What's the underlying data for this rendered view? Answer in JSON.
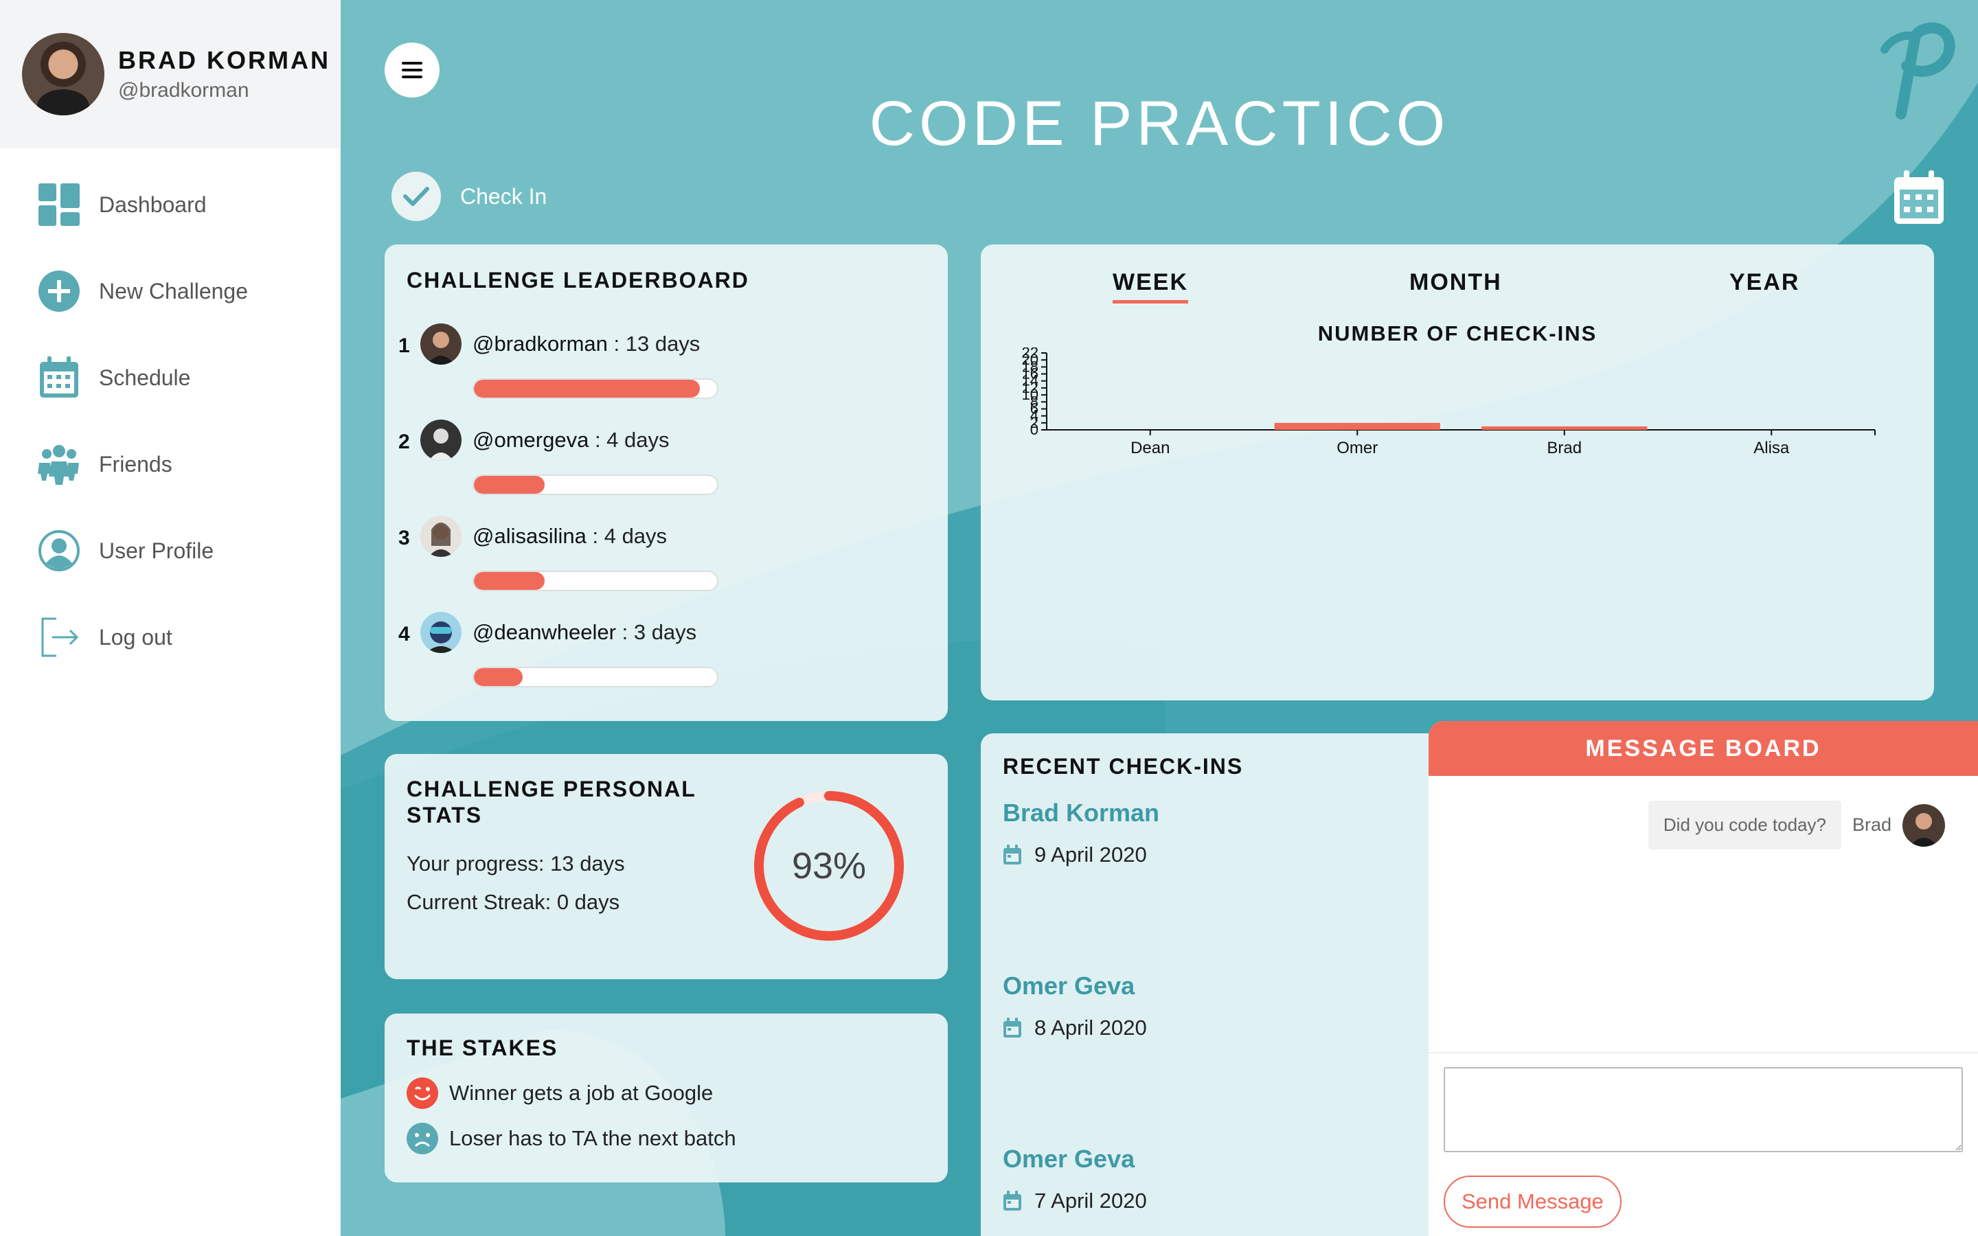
{
  "user": {
    "name": "BRAD KORMAN",
    "handle": "@bradkorman"
  },
  "sidebar": {
    "items": [
      {
        "label": "Dashboard",
        "icon": "dashboard-icon"
      },
      {
        "label": "New Challenge",
        "icon": "plus-circle-icon"
      },
      {
        "label": "Schedule",
        "icon": "calendar-icon"
      },
      {
        "label": "Friends",
        "icon": "friends-icon"
      },
      {
        "label": "User Profile",
        "icon": "user-icon"
      },
      {
        "label": "Log out",
        "icon": "logout-icon"
      }
    ]
  },
  "header": {
    "title": "CODE PRACTICO",
    "checkin_label": "Check In"
  },
  "leaderboard": {
    "title": "CHALLENGE LEADERBOARD",
    "entries": [
      {
        "rank": "1",
        "user": "@bradkorman",
        "days": " : 13 days",
        "progress": 0.93
      },
      {
        "rank": "2",
        "user": "@omergeva",
        "days": " : 4 days",
        "progress": 0.29
      },
      {
        "rank": "3",
        "user": "@alisasilina",
        "days": " : 4 days",
        "progress": 0.29
      },
      {
        "rank": "4",
        "user": "@deanwheeler",
        "days": " : 3 days",
        "progress": 0.2
      }
    ]
  },
  "chart_card": {
    "tabs": [
      "WEEK",
      "MONTH",
      "YEAR"
    ],
    "active_tab": "WEEK",
    "title": "NUMBER OF CHECK-INS"
  },
  "chart_data": {
    "type": "bar",
    "title": "NUMBER OF CHECK-INS",
    "categories": [
      "Dean",
      "Omer",
      "Brad",
      "Alisa"
    ],
    "values": [
      0,
      2,
      1,
      0
    ],
    "ylim": [
      0,
      22
    ],
    "yticks": [
      "0",
      "2",
      "4",
      "6",
      "8",
      "10",
      "12",
      "14",
      "16",
      "18",
      "20",
      "22"
    ],
    "xlabel": "",
    "ylabel": "",
    "color": "#f06a5a"
  },
  "stats": {
    "title": "CHALLENGE PERSONAL STATS",
    "progress_label": "Your progress:",
    "progress_value": " 13 days",
    "streak_label": "Current Streak:",
    "streak_value": " 0 days",
    "percent": "93%",
    "percent_value": 0.93
  },
  "stakes": {
    "title": "THE STAKES",
    "items": [
      {
        "text": "Winner gets a job at Google",
        "icon": "happy-face-icon"
      },
      {
        "text": "Loser has to TA the next batch",
        "icon": "sad-face-icon"
      }
    ]
  },
  "recent": {
    "title": "RECENT CHECK-INS",
    "entries": [
      {
        "name": "Brad Korman",
        "date": "9 April 2020"
      },
      {
        "name": "Omer Geva",
        "date": "8 April 2020"
      },
      {
        "name": "Omer Geva",
        "date": "7 April 2020"
      }
    ]
  },
  "message_board": {
    "title": "MESSAGE BOARD",
    "messages": [
      {
        "text": "Did you code today?",
        "author": "Brad"
      }
    ],
    "input_value": "",
    "send_label": "Send Message"
  },
  "colors": {
    "accent": "#f06a5a",
    "teal": "#74bfc5",
    "teal_dark": "#3d9aa6"
  }
}
